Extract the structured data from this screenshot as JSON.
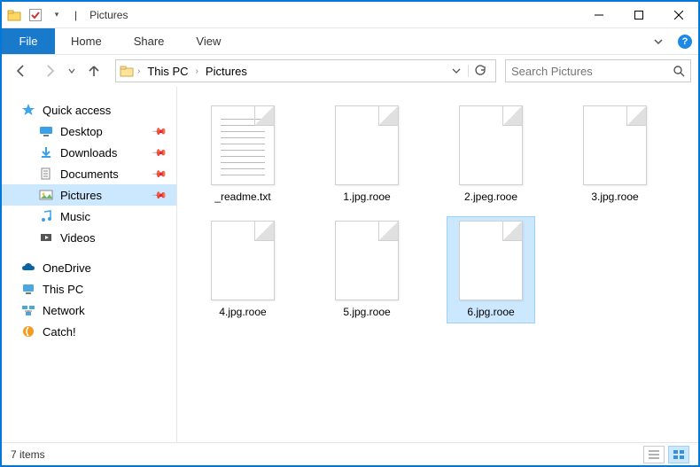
{
  "window": {
    "title": "Pictures"
  },
  "ribbon": {
    "file": "File",
    "tabs": [
      "Home",
      "Share",
      "View"
    ]
  },
  "breadcrumb": [
    {
      "label": "This PC"
    },
    {
      "label": "Pictures"
    }
  ],
  "search": {
    "placeholder": "Search Pictures"
  },
  "sidebar": {
    "quick_access": "Quick access",
    "quick_items": [
      {
        "label": "Desktop",
        "pinned": true
      },
      {
        "label": "Downloads",
        "pinned": true
      },
      {
        "label": "Documents",
        "pinned": true
      },
      {
        "label": "Pictures",
        "pinned": true,
        "selected": true
      },
      {
        "label": "Music",
        "pinned": false
      },
      {
        "label": "Videos",
        "pinned": false
      }
    ],
    "roots": [
      {
        "label": "OneDrive"
      },
      {
        "label": "This PC"
      },
      {
        "label": "Network"
      },
      {
        "label": "Catch!"
      }
    ]
  },
  "files": [
    {
      "name": "_readme.txt",
      "kind": "txt"
    },
    {
      "name": "1.jpg.rooe",
      "kind": "unknown"
    },
    {
      "name": "2.jpeg.rooe",
      "kind": "unknown"
    },
    {
      "name": "3.jpg.rooe",
      "kind": "unknown"
    },
    {
      "name": "4.jpg.rooe",
      "kind": "unknown"
    },
    {
      "name": "5.jpg.rooe",
      "kind": "unknown"
    },
    {
      "name": "6.jpg.rooe",
      "kind": "unknown",
      "selected": true
    }
  ],
  "status": {
    "items_text": "7 items"
  }
}
